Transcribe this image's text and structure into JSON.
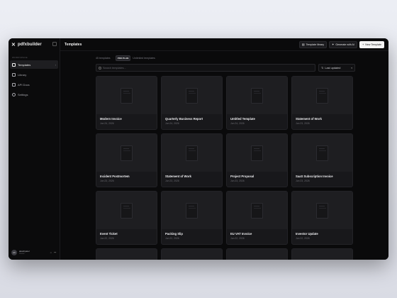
{
  "app": {
    "brand": "pdfxbuilder",
    "logo_glyph": "✕"
  },
  "sidebar": {
    "section_label": "Workspace",
    "items": [
      {
        "label": "Templates",
        "icon": "templates-icon",
        "active": true
      },
      {
        "label": "Library",
        "icon": "library-icon",
        "active": false
      },
      {
        "label": "API Docs",
        "icon": "api-docs-icon",
        "active": false
      },
      {
        "label": "Settings",
        "icon": "settings-icon",
        "active": false
      }
    ],
    "user": {
      "initials": "AK",
      "name": "akashpatel",
      "role": "Owner"
    }
  },
  "topbar": {
    "title": "Templates",
    "buttons": {
      "library": "Template library",
      "ai": "Generate with AI",
      "new": "New Template"
    }
  },
  "meta": {
    "count": "45 templates",
    "plan": "PRO PLAN",
    "limit": "Unlimited templates"
  },
  "search": {
    "placeholder": "Search templates..."
  },
  "sort": {
    "value": "Last updated"
  },
  "templates": [
    {
      "name": "Modern Invoice",
      "date": "Jun 24, 2026"
    },
    {
      "name": "Quarterly Business Report",
      "date": "Jun 24, 2026"
    },
    {
      "name": "Untitled Template",
      "date": "Jun 24, 2026"
    },
    {
      "name": "Statement of Work",
      "date": "Jun 23, 2026"
    },
    {
      "name": "Incident Postmortem",
      "date": "Jun 23, 2026"
    },
    {
      "name": "Statement of Work",
      "date": "Jun 23, 2026"
    },
    {
      "name": "Project Proposal",
      "date": "Jun 23, 2026"
    },
    {
      "name": "SaaS Subscription Invoice",
      "date": "Jun 23, 2026"
    },
    {
      "name": "Event Ticket",
      "date": "Jun 22, 2026"
    },
    {
      "name": "Packing Slip",
      "date": "Jun 22, 2026"
    },
    {
      "name": "EU VAT Invoice",
      "date": "Jun 22, 2026"
    },
    {
      "name": "Investor Update",
      "date": "Jun 22, 2026"
    }
  ],
  "colors": {
    "background": "#0b0b0c",
    "card": "#18181b",
    "primary_button": "#f3f3f3"
  }
}
